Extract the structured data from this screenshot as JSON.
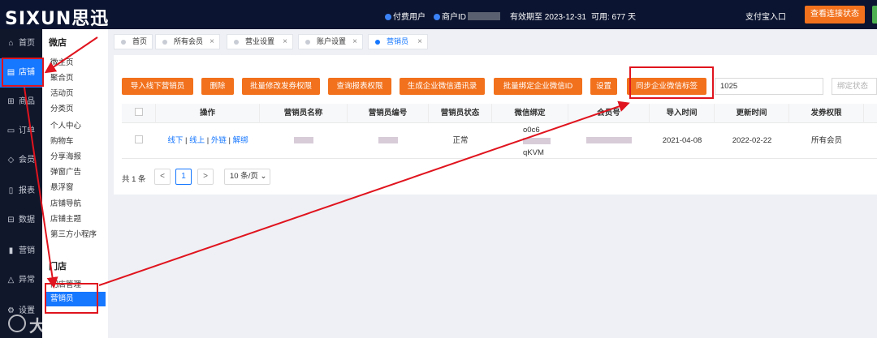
{
  "brand": {
    "logo_text": "SIXUN思迅"
  },
  "topbar": {
    "paid_user": "付费用户",
    "merchant_id_label": "商户ID",
    "valid_until": "有效期至 2023-12-31",
    "available": "可用: 677 天",
    "alipay_entry": "支付宝入口",
    "view_connection_button": "查看连接状态"
  },
  "sidebar": {
    "items": [
      {
        "label": "首页",
        "icon": "home-icon"
      },
      {
        "label": "店铺",
        "icon": "store-icon"
      },
      {
        "label": "商品",
        "icon": "goods-icon"
      },
      {
        "label": "订单",
        "icon": "order-icon"
      },
      {
        "label": "会员",
        "icon": "member-icon"
      },
      {
        "label": "报表",
        "icon": "report-icon"
      },
      {
        "label": "数据",
        "icon": "data-icon"
      },
      {
        "label": "营销",
        "icon": "marketing-icon"
      },
      {
        "label": "异常",
        "icon": "warning-icon"
      },
      {
        "label": "设置",
        "icon": "settings-icon"
      }
    ]
  },
  "submenu": {
    "section1_title": "微店",
    "section1_items": [
      "微主页",
      "聚合页",
      "活动页",
      "分类页",
      "个人中心",
      "购物车",
      "分享海报",
      "弹窗广告",
      "悬浮窗",
      "店铺导航",
      "店铺主题",
      "第三方小程序"
    ],
    "section2_title": "门店",
    "section2_items": [
      "门店管理",
      "营销员"
    ]
  },
  "tabs": [
    {
      "label": "首页"
    },
    {
      "label": "所有会员"
    },
    {
      "label": "营业设置"
    },
    {
      "label": "账户设置"
    },
    {
      "label": "营销员"
    }
  ],
  "toolbar": {
    "import_button": "导入线下营销员",
    "delete_button": "删除",
    "batch_permission_button": "批量修改发券权限",
    "query_report_button": "查询报表权限",
    "gen_contacts_button": "生成企业微信通讯录",
    "batch_bind_button": "批量绑定企业微信ID",
    "settings_button": "设置",
    "sync_tags_button": "同步企业微信标签",
    "tag_input_value": "1025",
    "bind_status_placeholder": "绑定状态"
  },
  "table": {
    "headers": [
      "操作",
      "营销员名称",
      "营销员编号",
      "营销员状态",
      "微信绑定",
      "会员号",
      "导入时间",
      "更新时间",
      "发券权限"
    ],
    "row": {
      "actions": [
        "线下",
        "线上",
        "外链",
        "解绑"
      ],
      "action_sep": " | ",
      "status": "正常",
      "wechat_line1": "o0c6",
      "wechat_line3": "qKVM",
      "import_time": "2021-04-08",
      "update_time": "2022-02-22",
      "coupon_permission": "所有会员"
    }
  },
  "pagination": {
    "total": "共 1 条",
    "prev": "<",
    "current": "1",
    "next": ">",
    "page_size": "10 条/页"
  },
  "watermark": {
    "text": "大数跨境"
  },
  "colors": {
    "accent": "#1677ff",
    "orange": "#f2711c",
    "annotation_red": "#e0141e",
    "topbar": "#0b1430"
  }
}
